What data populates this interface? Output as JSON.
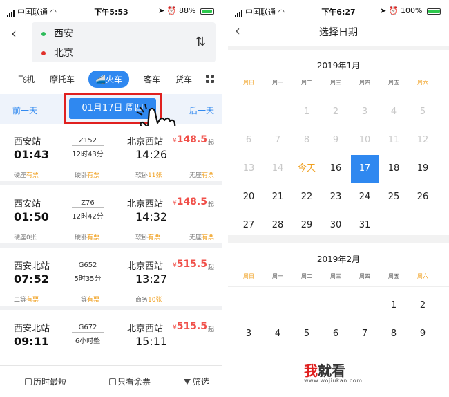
{
  "left_screen": {
    "status": {
      "carrier": "中国联通",
      "time": "下午5:53",
      "battery": "88%"
    },
    "route": {
      "from": "西安",
      "to": "北京",
      "from_color": "#2dbb5a",
      "to_color": "#e0302a"
    },
    "modes": [
      "飞机",
      "摩托车",
      "火车",
      "客车",
      "货车"
    ],
    "active_mode": "火车",
    "date_nav": {
      "prev": "前一天",
      "current": "01月17日 周四",
      "next": "后一天"
    },
    "trains": [
      {
        "from": "西安站",
        "dep": "01:43",
        "code": "Z152",
        "duration": "12时43分",
        "to": "北京西站",
        "arr": "14:26",
        "price": "148.5",
        "price_suffix": "起",
        "seats": [
          {
            "type": "硬座",
            "status": "有票",
            "available": true
          },
          {
            "type": "硬卧",
            "status": "有票",
            "available": true
          },
          {
            "type": "软卧",
            "status": "11张",
            "available": true
          },
          {
            "type": "无座",
            "status": "有票",
            "available": true
          }
        ]
      },
      {
        "from": "西安站",
        "dep": "01:50",
        "code": "Z76",
        "duration": "12时42分",
        "to": "北京西站",
        "arr": "14:32",
        "price": "148.5",
        "price_suffix": "起",
        "seats": [
          {
            "type": "硬座",
            "status": "0张",
            "available": false
          },
          {
            "type": "硬卧",
            "status": "有票",
            "available": true
          },
          {
            "type": "软卧",
            "status": "有票",
            "available": true
          },
          {
            "type": "无座",
            "status": "有票",
            "available": true
          }
        ]
      },
      {
        "from": "西安北站",
        "dep": "07:52",
        "code": "G652",
        "duration": "5时35分",
        "to": "北京西站",
        "arr": "13:27",
        "price": "515.5",
        "price_suffix": "起",
        "seats": [
          {
            "type": "二等",
            "status": "有票",
            "available": true
          },
          {
            "type": "一等",
            "status": "有票",
            "available": true
          },
          {
            "type": "商务",
            "status": "10张",
            "available": true
          }
        ]
      },
      {
        "from": "西安北站",
        "dep": "09:11",
        "code": "G672",
        "duration": "6小时整",
        "to": "北京西站",
        "arr": "15:11",
        "price": "515.5",
        "price_suffix": "起",
        "seats": []
      }
    ],
    "bottom": {
      "shortest": "历时最短",
      "only_available": "只看余票",
      "filter": "筛选"
    }
  },
  "right_screen": {
    "status": {
      "carrier": "中国联通",
      "time": "下午6:27",
      "battery": "100%"
    },
    "title": "选择日期",
    "weekdays": [
      "周日",
      "周一",
      "周二",
      "周三",
      "周四",
      "周五",
      "周六"
    ],
    "months": [
      {
        "title": "2019年1月",
        "days": [
          {
            "label": "1",
            "state": "past"
          },
          {
            "label": "2",
            "state": "past"
          },
          {
            "label": "3",
            "state": "past"
          },
          {
            "label": "4",
            "state": "past"
          },
          {
            "label": "5",
            "state": "past"
          },
          {
            "label": "6",
            "state": "past"
          },
          {
            "label": "7",
            "state": "past"
          },
          {
            "label": "8",
            "state": "past"
          },
          {
            "label": "9",
            "state": "past"
          },
          {
            "label": "10",
            "state": "past"
          },
          {
            "label": "11",
            "state": "past"
          },
          {
            "label": "12",
            "state": "past"
          },
          {
            "label": "13",
            "state": "past"
          },
          {
            "label": "14",
            "state": "past"
          },
          {
            "label": "今天",
            "state": "today"
          },
          {
            "label": "16",
            "state": "normal"
          },
          {
            "label": "17",
            "state": "selected"
          },
          {
            "label": "18",
            "state": "normal"
          },
          {
            "label": "19",
            "state": "normal"
          },
          {
            "label": "20",
            "state": "normal"
          },
          {
            "label": "21",
            "state": "normal"
          },
          {
            "label": "22",
            "state": "normal"
          },
          {
            "label": "23",
            "state": "normal"
          },
          {
            "label": "24",
            "state": "normal"
          },
          {
            "label": "25",
            "state": "normal"
          },
          {
            "label": "26",
            "state": "normal"
          },
          {
            "label": "27",
            "state": "normal"
          },
          {
            "label": "28",
            "state": "normal"
          },
          {
            "label": "29",
            "state": "normal"
          },
          {
            "label": "30",
            "state": "normal"
          },
          {
            "label": "31",
            "state": "normal"
          }
        ]
      },
      {
        "title": "2019年2月",
        "days": [
          {
            "label": "1",
            "state": "normal"
          },
          {
            "label": "2",
            "state": "normal"
          },
          {
            "label": "3",
            "state": "normal"
          },
          {
            "label": "4",
            "state": "normal"
          },
          {
            "label": "5",
            "state": "normal"
          },
          {
            "label": "6",
            "state": "normal"
          },
          {
            "label": "7",
            "state": "normal"
          },
          {
            "label": "8",
            "state": "normal"
          },
          {
            "label": "9",
            "state": "normal"
          }
        ]
      }
    ]
  },
  "watermark": {
    "char": "我",
    "text": "就看",
    "url": "www.wojiukan.com"
  },
  "colors": {
    "accent": "#2f88f0",
    "price": "#f0504a",
    "available": "#f0a020",
    "highlight_frame": "#e0201f"
  }
}
